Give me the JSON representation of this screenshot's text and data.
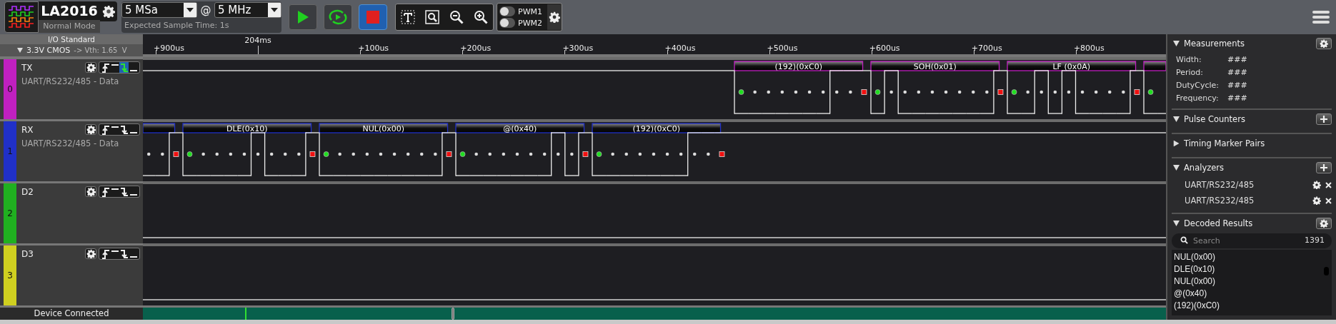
{
  "toolbar": {
    "device": "LA2016",
    "mode": "Normal Mode",
    "sample_rate": "5 MSa",
    "at": "@",
    "frequency": "5 MHz",
    "expected": "Expected Sample Time: 1s",
    "pwm": [
      {
        "label": "PWM1",
        "on": false
      },
      {
        "label": "PWM2",
        "on": false
      }
    ]
  },
  "io_standard": {
    "title": "I/O Standard",
    "expanded": true,
    "value": "3.3V CMOS",
    "threshold": "-> Vth: 1.65  V"
  },
  "timeline": {
    "ticks": [
      {
        "label": "+900us",
        "kind": "minor"
      },
      {
        "label": "204ms",
        "kind": "major"
      },
      {
        "label": "+100us",
        "kind": "minor"
      },
      {
        "label": "+200us",
        "kind": "minor"
      },
      {
        "label": "+300us",
        "kind": "minor"
      },
      {
        "label": "+400us",
        "kind": "minor"
      },
      {
        "label": "+500us",
        "kind": "minor"
      },
      {
        "label": "+600us",
        "kind": "minor"
      },
      {
        "label": "+700us",
        "kind": "minor"
      },
      {
        "label": "+800us",
        "kind": "minor"
      }
    ]
  },
  "channels": [
    {
      "name": "TX",
      "number": "0",
      "color": "#c020c0",
      "description": "UART/RS232/485 - Data",
      "idle_high": true,
      "triggers": [
        {
          "kind": "rising",
          "selected": false
        },
        {
          "kind": "high",
          "selected": false
        },
        {
          "kind": "falling",
          "selected": true
        },
        {
          "kind": "low",
          "selected": false
        }
      ],
      "frames": [
        {
          "label": "(192)(0xC0)",
          "bits": [
            false,
            false,
            false,
            false,
            false,
            false,
            true,
            true
          ]
        },
        {
          "label": "SOH(0x01)",
          "bits": [
            true,
            false,
            false,
            false,
            false,
            false,
            false,
            false
          ]
        },
        {
          "label": "LF (0x0A)",
          "bits": [
            false,
            true,
            false,
            true,
            false,
            false,
            false,
            false
          ]
        },
        {
          "cut_right": true,
          "bits": [
            false
          ]
        }
      ]
    },
    {
      "name": "RX",
      "number": "1",
      "color": "#2030c8",
      "description": "UART/RS232/485 - Data",
      "idle_high": true,
      "triggers": [
        {
          "kind": "rising",
          "selected": false
        },
        {
          "kind": "high",
          "selected": false
        },
        {
          "kind": "falling",
          "selected": false
        },
        {
          "kind": "low",
          "selected": false
        }
      ],
      "frames": [
        {
          "cut_left": true,
          "bits": [
            false,
            false
          ]
        },
        {
          "label": "DLE(0x10)",
          "bits": [
            false,
            false,
            false,
            false,
            true,
            false,
            false,
            false
          ]
        },
        {
          "label": "NUL(0x00)",
          "bits": [
            false,
            false,
            false,
            false,
            false,
            false,
            false,
            false
          ]
        },
        {
          "label": "@(0x40)",
          "bits": [
            false,
            false,
            false,
            false,
            false,
            false,
            true,
            false
          ]
        },
        {
          "label": "(192)(0xC0)",
          "bits": [
            false,
            false,
            false,
            false,
            false,
            false,
            true,
            true
          ]
        }
      ]
    },
    {
      "name": "D2",
      "number": "2",
      "color": "#20b020",
      "idle_high": false,
      "triggers": [
        {
          "kind": "rising",
          "selected": false
        },
        {
          "kind": "high",
          "selected": false
        },
        {
          "kind": "falling",
          "selected": false
        },
        {
          "kind": "low",
          "selected": false
        }
      ]
    },
    {
      "name": "D3",
      "number": "3",
      "color": "#d0d020",
      "idle_high": false,
      "triggers": [
        {
          "kind": "rising",
          "selected": false
        },
        {
          "kind": "high",
          "selected": false
        },
        {
          "kind": "falling",
          "selected": false
        },
        {
          "kind": "low",
          "selected": false
        }
      ]
    }
  ],
  "status": "Device Connected",
  "measurements": {
    "title": "Measurements",
    "expanded": true,
    "rows": [
      {
        "label": "Width:",
        "value": "###"
      },
      {
        "label": "Period:",
        "value": "###"
      },
      {
        "label": "DutyCycle:",
        "value": "###"
      },
      {
        "label": "Frequency:",
        "value": "###"
      }
    ]
  },
  "pulse_counters": {
    "title": "Pulse Counters",
    "expanded": true
  },
  "timing_marker_pairs": {
    "title": "Timing Marker Pairs",
    "expanded": false
  },
  "analyzers": {
    "title": "Analyzers",
    "expanded": true,
    "items": [
      "UART/RS232/485",
      "UART/RS232/485"
    ]
  },
  "decoded_results": {
    "title": "Decoded Results",
    "expanded": true,
    "placeholder": "Search",
    "count": "1391",
    "items": [
      "NUL(0x00)",
      "DLE(0x10)",
      "NUL(0x00)",
      "@(0x40)",
      "(192)(0xC0)"
    ]
  }
}
